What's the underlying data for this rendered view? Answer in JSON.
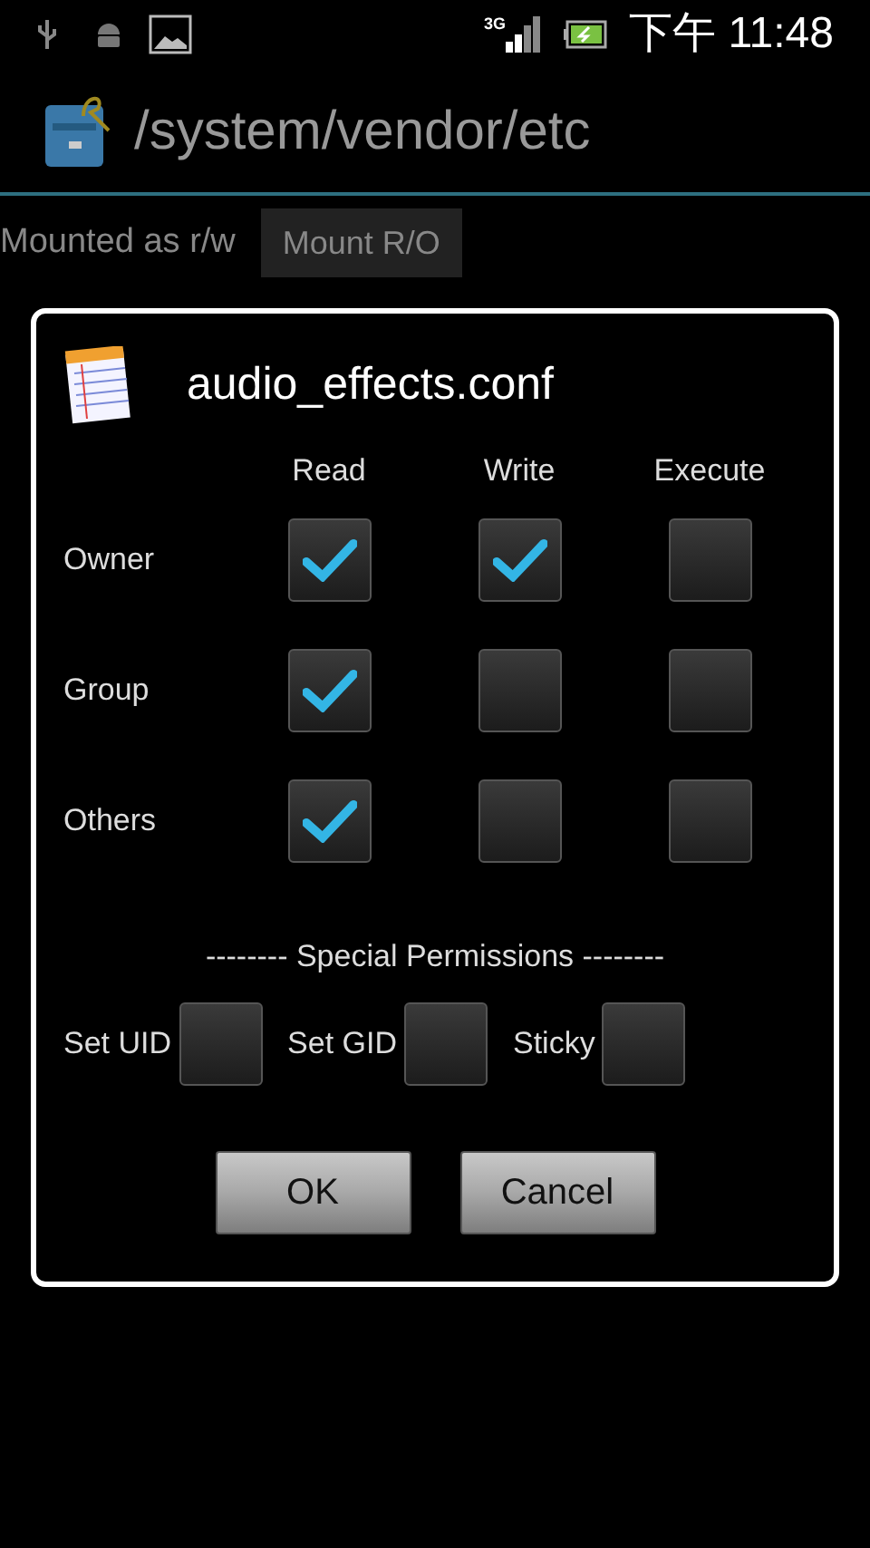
{
  "status_bar": {
    "network": "3G",
    "time": "下午 11:48"
  },
  "title_bar": {
    "path": "/system/vendor/etc"
  },
  "mount": {
    "label": "Mounted as r/w",
    "button": "Mount R/O"
  },
  "dialog": {
    "title": "audio_effects.conf",
    "columns": [
      "Read",
      "Write",
      "Execute"
    ],
    "rows": [
      {
        "label": "Owner",
        "checks": [
          true,
          true,
          false
        ]
      },
      {
        "label": "Group",
        "checks": [
          true,
          false,
          false
        ]
      },
      {
        "label": "Others",
        "checks": [
          true,
          false,
          false
        ]
      }
    ],
    "special_heading": "-------- Special Permissions --------",
    "special": [
      {
        "label": "Set UID",
        "checked": false
      },
      {
        "label": "Set GID",
        "checked": false
      },
      {
        "label": "Sticky",
        "checked": false
      }
    ],
    "buttons": [
      "OK",
      "Cancel"
    ]
  }
}
